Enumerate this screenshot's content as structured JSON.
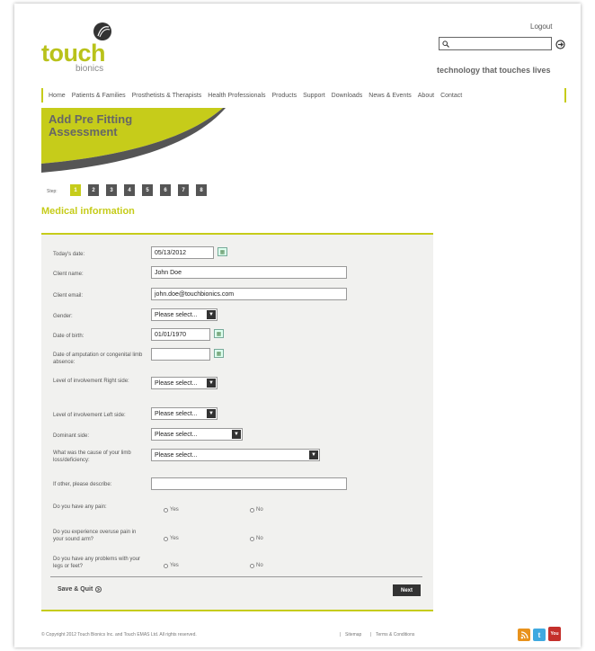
{
  "header": {
    "logo_word": "touch",
    "logo_sub": "bionics",
    "logout": "Logout",
    "search_placeholder": "",
    "search_icon": "search-icon",
    "go_icon": "arrow-right-icon",
    "tagline": "technology that touches lives"
  },
  "nav": {
    "items": [
      "Home",
      "Patients & Families",
      "Prosthetists & Therapists",
      "Health Professionals",
      "Products",
      "Support",
      "Downloads",
      "News & Events",
      "About",
      "Contact"
    ]
  },
  "banner": {
    "title_line1": "Add Pre Fitting",
    "title_line2": "Assessment"
  },
  "steps": {
    "label": "Step:",
    "items": [
      "1",
      "2",
      "3",
      "4",
      "5",
      "6",
      "7",
      "8"
    ],
    "active": "1"
  },
  "section": {
    "title": "Medical information"
  },
  "form": {
    "todays_date_label": "Today's date:",
    "todays_date_value": "05/13/2012",
    "client_name_label": "Client name:",
    "client_name_value": "John Doe",
    "client_email_label": "Client email:",
    "client_email_value": "john.doe@touchbionics.com",
    "gender_label": "Gender:",
    "gender_value": "Please select...",
    "dob_label": "Date of birth:",
    "dob_value": "01/01/1970",
    "amputation_label": "Date of amputation or congenital limb absence:",
    "amputation_value": "",
    "involve_right_label": "Level of involvement Right side:",
    "involve_right_value": "Please select...",
    "involve_left_label": "Level of involvement Left side:",
    "involve_left_value": "Please select...",
    "dominant_label": "Dominant side:",
    "dominant_value": "Please select...",
    "cause_label": "What was the cause of your limb loss/deficiency:",
    "cause_value": "Please select...",
    "other_label": "If other, please describe:",
    "other_value": "",
    "pain_label": "Do you have any pain:",
    "overuse_label": "Do you experience overuse pain in your sound arm?",
    "problems_label": "Do you have any problems with your legs or feet?",
    "yes": "Yes",
    "no": "No",
    "save_quit": "Save & Quit",
    "next": "Next"
  },
  "footer": {
    "copyright": "© Copyright 2012 Touch Bionics Inc. and Touch EMAS Ltd. All rights reserved.",
    "sitemap": "Sitemap",
    "terms": "Terms & Conditions",
    "rss_icon": "rss-icon",
    "twitter_icon": "twitter-icon",
    "youtube_icon": "youtube-icon",
    "youtube_text": "You"
  },
  "colors": {
    "accent": "#c6cc1a",
    "dark": "#555555"
  }
}
